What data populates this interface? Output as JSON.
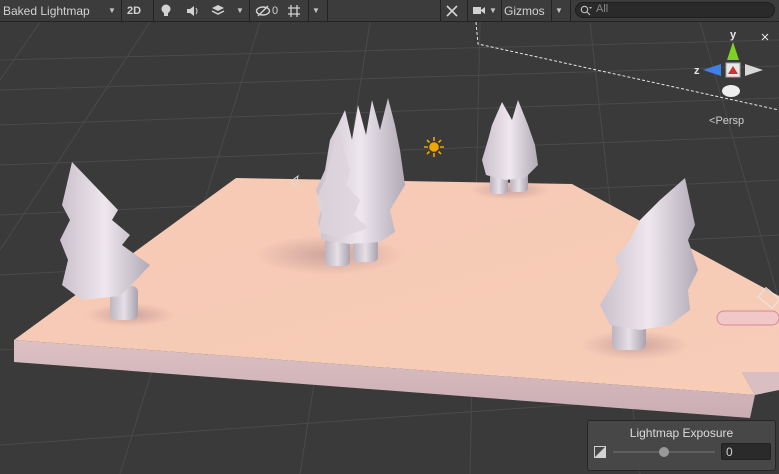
{
  "toolbar": {
    "draw_mode": "Baked Lightmap",
    "mode_2d": "2D",
    "hidden_count": "0",
    "gizmos_label": "Gizmos",
    "search_placeholder": "All"
  },
  "scene": {
    "orientation_y": "y",
    "orientation_z": "z",
    "projection_label": "Persp"
  },
  "overlay": {
    "title": "Lightmap Exposure",
    "exposure_value": "0",
    "slider_fraction": 0.5
  },
  "colors": {
    "toolbar_bg": "#3c3c3c",
    "viewport_bg": "#3a3a3a",
    "ground_top": "#f5c7b2",
    "ground_side": "#d4b6ba",
    "y_axis": "#7ed321",
    "z_axis": "#3f7fe8"
  },
  "icons": [
    "caret-down-icon",
    "light-bulb-icon",
    "speaker-icon",
    "fx-layers-icon",
    "eye-slash-icon",
    "grid-icon",
    "tools-icon",
    "camera-icon",
    "search-icon",
    "sun-icon",
    "axis-gizmo-icon",
    "resize-icon"
  ]
}
